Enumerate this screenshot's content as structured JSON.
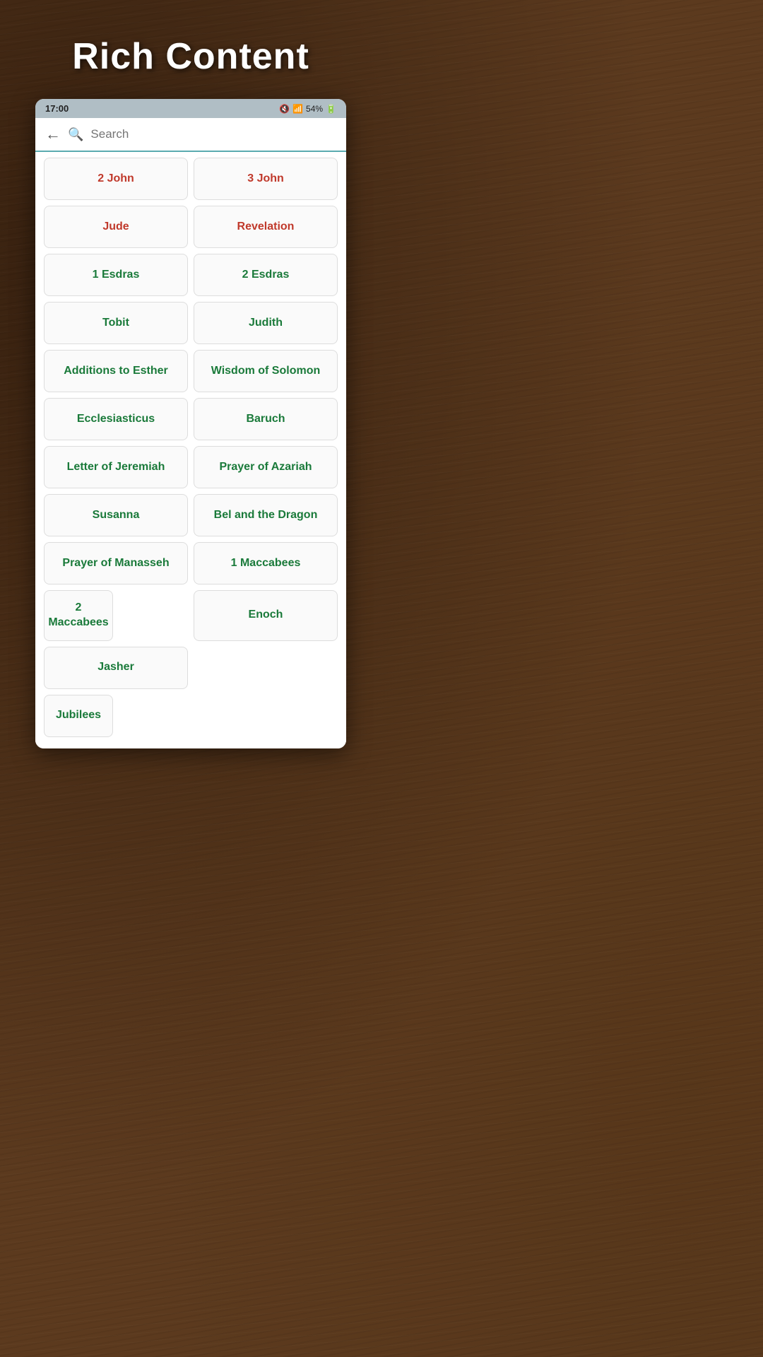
{
  "hero": {
    "title": "Rich Content"
  },
  "status_bar": {
    "time": "17:00",
    "battery": "54%"
  },
  "search": {
    "placeholder": "Search"
  },
  "books": [
    {
      "label": "2 John",
      "color": "red",
      "span": false
    },
    {
      "label": "3 John",
      "color": "red",
      "span": false
    },
    {
      "label": "Jude",
      "color": "red",
      "span": false
    },
    {
      "label": "Revelation",
      "color": "red",
      "span": false
    },
    {
      "label": "1 Esdras",
      "color": "green",
      "span": false
    },
    {
      "label": "2 Esdras",
      "color": "green",
      "span": false
    },
    {
      "label": "Tobit",
      "color": "green",
      "span": false
    },
    {
      "label": "Judith",
      "color": "green",
      "span": false
    },
    {
      "label": "Additions to Esther",
      "color": "green",
      "span": false
    },
    {
      "label": "Wisdom of Solomon",
      "color": "green",
      "span": false
    },
    {
      "label": "Ecclesiasticus",
      "color": "green",
      "span": false
    },
    {
      "label": "Baruch",
      "color": "green",
      "span": false
    },
    {
      "label": "Letter of Jeremiah",
      "color": "green",
      "span": false
    },
    {
      "label": "Prayer of Azariah",
      "color": "green",
      "span": false
    },
    {
      "label": "Susanna",
      "color": "green",
      "span": false
    },
    {
      "label": "Bel and the Dragon",
      "color": "green",
      "span": false
    },
    {
      "label": "Prayer of Manasseh",
      "color": "green",
      "span": false
    },
    {
      "label": "1 Maccabees",
      "color": "green",
      "span": false
    },
    {
      "label": "2 Maccabees",
      "color": "green",
      "span": true
    },
    {
      "label": "Enoch",
      "color": "green",
      "span": false
    },
    {
      "label": "Jasher",
      "color": "green",
      "span": false
    },
    {
      "label": "Jubilees",
      "color": "green",
      "span": true
    }
  ]
}
